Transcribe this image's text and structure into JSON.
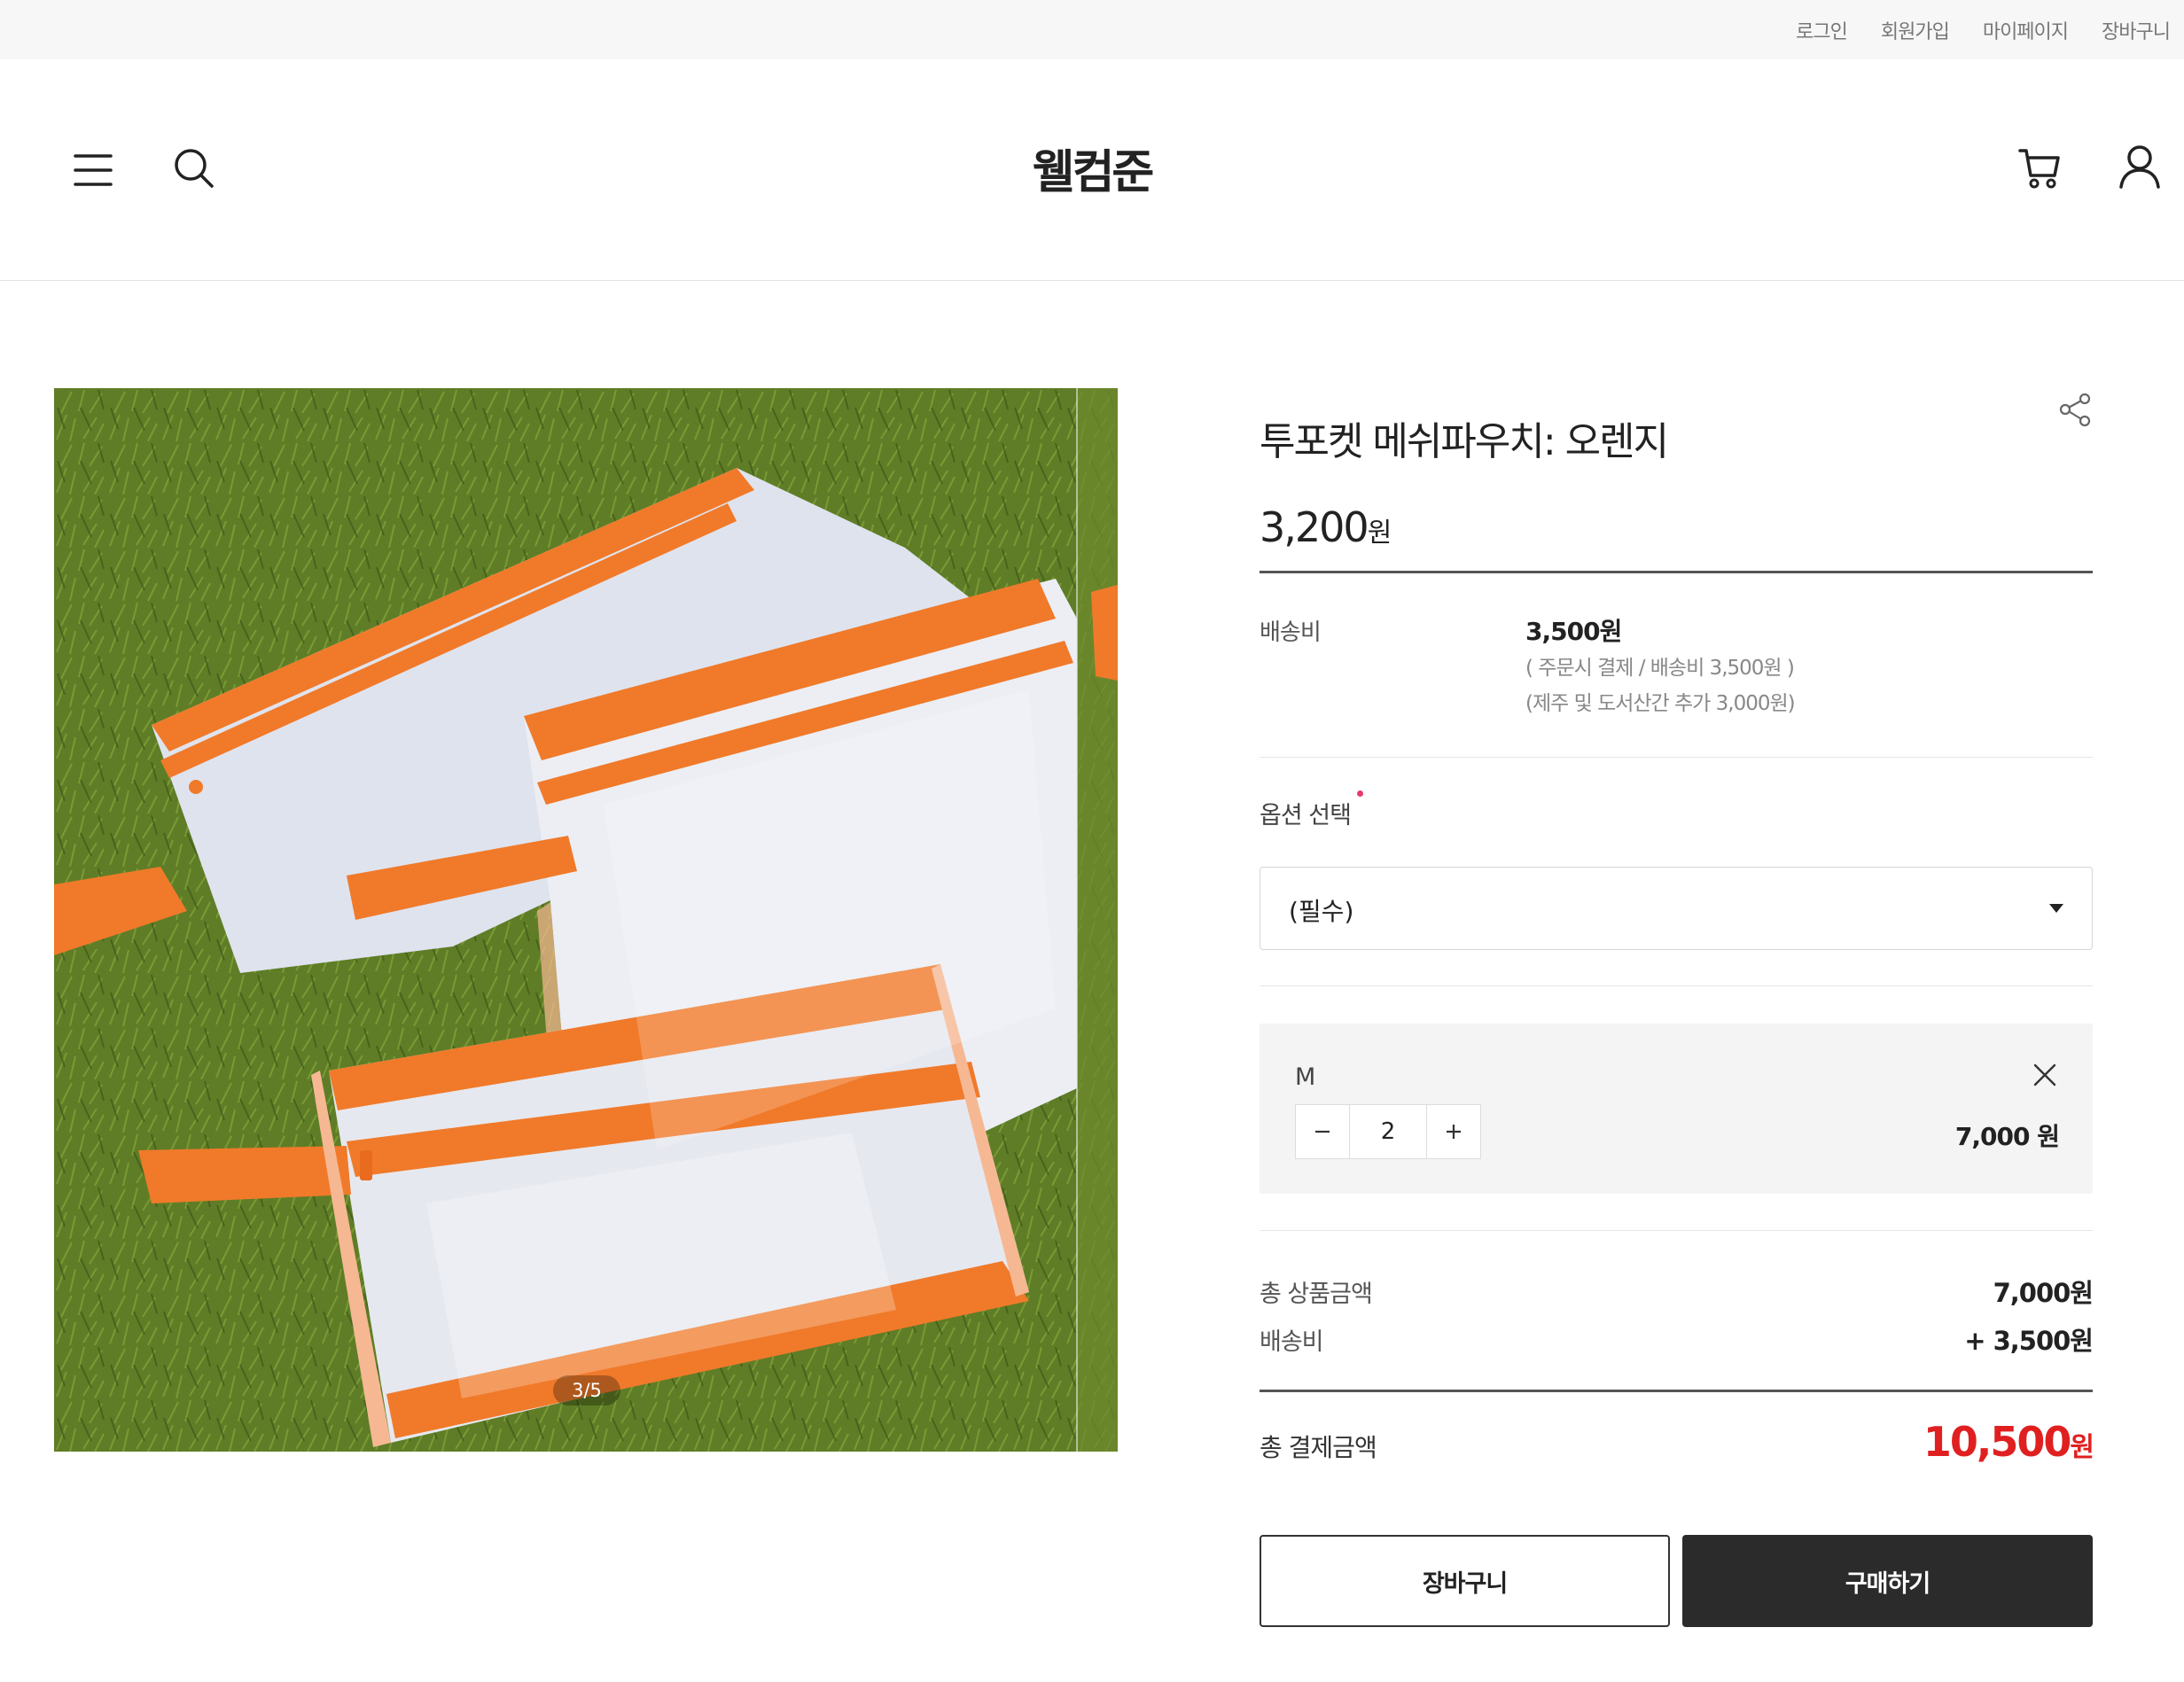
{
  "top_links": {
    "login": "로그인",
    "signup": "회원가입",
    "mypage": "마이페이지",
    "cart": "장바구니"
  },
  "header": {
    "logo": "웰컴준",
    "icons": [
      "menu-icon",
      "search-icon",
      "cart-icon",
      "user-icon"
    ]
  },
  "gallery": {
    "counter": "3/5",
    "current_index": 3,
    "total": 5
  },
  "product": {
    "title": "투포켓 메쉬파우치: 오렌지",
    "price": "3,200",
    "price_unit": "원"
  },
  "shipping": {
    "label": "배송비",
    "value": "3,500원",
    "note1": "( 주문시 결제 / 배송비 3,500원 )",
    "note2": "(제주 및 도서산간 추가 3,000원)"
  },
  "option": {
    "label": "옵션 선택",
    "selected": "(필수)"
  },
  "selected_option": {
    "name": "M",
    "quantity": "2",
    "price": "7,000 원"
  },
  "summary": {
    "subtotal_label": "총 상품금액",
    "subtotal_value": "7,000원",
    "shipping_label": "배송비",
    "shipping_value": "+ 3,500원",
    "total_label": "총 결제금액",
    "total_value": "10,500",
    "total_unit": "원"
  },
  "buttons": {
    "cart": "장바구니",
    "buy": "구매하기"
  },
  "colors": {
    "accent_red": "#e02020",
    "buy_button": "#2b2b2b",
    "required_dot": "#e83a6b",
    "pouch_orange": "#f07a2a"
  }
}
